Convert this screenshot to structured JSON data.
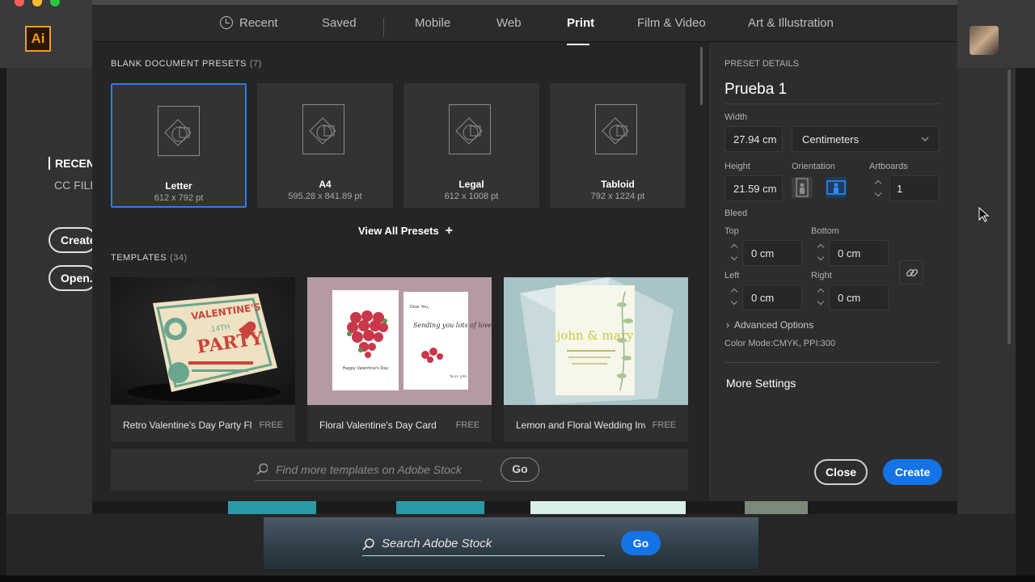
{
  "colors": {
    "accent": "#1473e6",
    "select_border": "#2d7de8",
    "ai_orange": "#f29a1f"
  },
  "app": {
    "logo_text": "Ai",
    "sidebar_recent": "RECENT",
    "sidebar_ccfiles": "CC FILE",
    "create_button": "Create",
    "open_button": "Open...",
    "stock_search_placeholder": "Search Adobe Stock",
    "stock_go": "Go"
  },
  "tabs": [
    {
      "label": "Recent",
      "icon": "clock-icon"
    },
    {
      "label": "Saved"
    },
    {
      "label": "Mobile"
    },
    {
      "label": "Web"
    },
    {
      "label": "Print",
      "active": true
    },
    {
      "label": "Film & Video"
    },
    {
      "label": "Art & Illustration"
    }
  ],
  "presets_section": {
    "title": "BLANK DOCUMENT PRESETS",
    "count": "(7)"
  },
  "presets": [
    {
      "name": "Letter",
      "size": "612 x 792 pt",
      "selected": true
    },
    {
      "name": "A4",
      "size": "595.28 x 841.89 pt"
    },
    {
      "name": "Legal",
      "size": "612 x 1008 pt"
    },
    {
      "name": "Tabloid",
      "size": "792 x 1224 pt"
    }
  ],
  "view_all": "View All Presets",
  "templates_section": {
    "title": "TEMPLATES",
    "count": "(34)"
  },
  "templates": [
    {
      "name": "Retro Valentine's Day Party Flyer",
      "badge": "FREE",
      "flyer_top": "VALENTINE'S",
      "flyer_main": "PARTY",
      "flyer_date": "14TH"
    },
    {
      "name": "Floral Valentine's Day Card",
      "badge": "FREE",
      "card_text": "Happy Valentine's Day",
      "card_dear": "Dear You,",
      "card_script": "Sending you lots of love",
      "card_sign": "Yours, John"
    },
    {
      "name": "Lemon and Floral Wedding Invita...",
      "badge": "FREE",
      "invite_names": "john & mary"
    }
  ],
  "stock": {
    "placeholder": "Find more templates on Adobe Stock",
    "go": "Go"
  },
  "details": {
    "heading": "PRESET DETAILS",
    "name": "Prueba 1",
    "width_label": "Width",
    "width": "27.94 cm",
    "units": "Centimeters",
    "height_label": "Height",
    "height": "21.59 cm",
    "orientation_label": "Orientation",
    "orientation": "landscape",
    "artboards_label": "Artboards",
    "artboards": "1",
    "bleed_label": "Bleed",
    "top_label": "Top",
    "top": "0 cm",
    "bottom_label": "Bottom",
    "bottom": "0 cm",
    "left_label": "Left",
    "left": "0 cm",
    "right_label": "Right",
    "right": "0 cm",
    "advanced": "Advanced Options",
    "color_mode": "Color Mode:CMYK, PPI:300",
    "more_settings": "More Settings",
    "close": "Close",
    "create": "Create"
  }
}
